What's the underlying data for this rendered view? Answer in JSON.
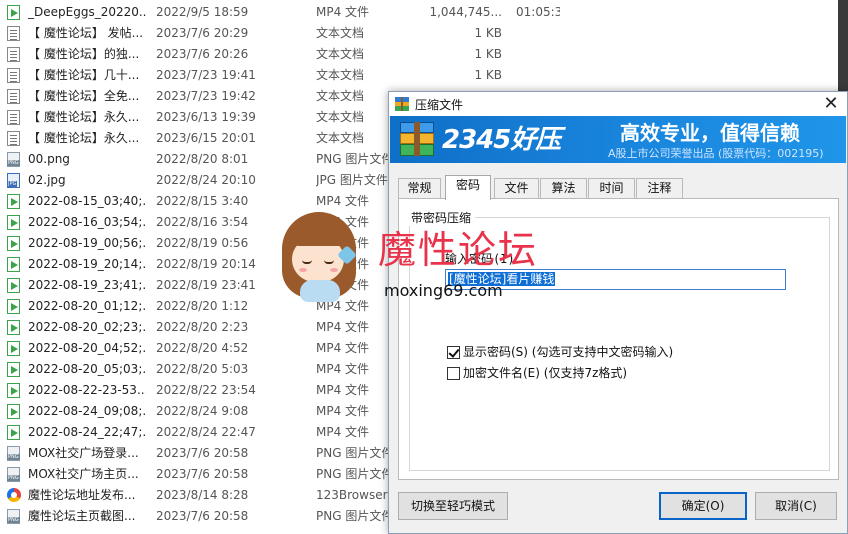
{
  "files": [
    {
      "icon": "mp4",
      "name": "_DeepEggs_20220...",
      "date": "2022/9/5 18:59",
      "type": "MP4 文件",
      "size": "1,044,745...",
      "duration": "01:05:33"
    },
    {
      "icon": "text",
      "name": "【 魔性论坛】 发帖...",
      "date": "2023/7/6 20:29",
      "type": "文本文档",
      "size": "1 KB",
      "duration": ""
    },
    {
      "icon": "text",
      "name": "【 魔性论坛】的独...",
      "date": "2023/7/6 20:26",
      "type": "文本文档",
      "size": "1 KB",
      "duration": ""
    },
    {
      "icon": "text",
      "name": "【 魔性论坛】几十...",
      "date": "2023/7/23 19:41",
      "type": "文本文档",
      "size": "1 KB",
      "duration": ""
    },
    {
      "icon": "text",
      "name": "【 魔性论坛】全免...",
      "date": "2023/7/23 19:42",
      "type": "文本文档",
      "size": "1 KB",
      "duration": ""
    },
    {
      "icon": "text",
      "name": "【 魔性论坛】永久...",
      "date": "2023/6/13 19:39",
      "type": "文本文档",
      "size": "1 KB",
      "duration": ""
    },
    {
      "icon": "text",
      "name": "【 魔性论坛】永久...",
      "date": "2023/6/15 20:01",
      "type": "文本文档",
      "size": "",
      "duration": ""
    },
    {
      "icon": "png",
      "name": "00.png",
      "date": "2022/8/20 8:01",
      "type": "PNG 图片文件",
      "size": "",
      "duration": ""
    },
    {
      "icon": "jpg",
      "name": "02.jpg",
      "date": "2022/8/24 20:10",
      "type": "JPG 图片文件",
      "size": "",
      "duration": ""
    },
    {
      "icon": "mp4",
      "name": "2022-08-15_03;40;...",
      "date": "2022/8/15 3:40",
      "type": "MP4 文件",
      "size": "",
      "duration": ""
    },
    {
      "icon": "mp4",
      "name": "2022-08-16_03;54;...",
      "date": "2022/8/16 3:54",
      "type": "MP4 文件",
      "size": "",
      "duration": ""
    },
    {
      "icon": "mp4",
      "name": "2022-08-19_00;56;...",
      "date": "2022/8/19 0:56",
      "type": "MP4 文件",
      "size": "",
      "duration": ""
    },
    {
      "icon": "mp4",
      "name": "2022-08-19_20;14;...",
      "date": "2022/8/19 20:14",
      "type": "MP4 文件",
      "size": "",
      "duration": ""
    },
    {
      "icon": "mp4",
      "name": "2022-08-19_23;41;...",
      "date": "2022/8/19 23:41",
      "type": "MP4 文件",
      "size": "",
      "duration": ""
    },
    {
      "icon": "mp4",
      "name": "2022-08-20_01;12;...",
      "date": "2022/8/20 1:12",
      "type": "MP4 文件",
      "size": "",
      "duration": ""
    },
    {
      "icon": "mp4",
      "name": "2022-08-20_02;23;...",
      "date": "2022/8/20 2:23",
      "type": "MP4 文件",
      "size": "",
      "duration": ""
    },
    {
      "icon": "mp4",
      "name": "2022-08-20_04;52;...",
      "date": "2022/8/20 4:52",
      "type": "MP4 文件",
      "size": "",
      "duration": ""
    },
    {
      "icon": "mp4",
      "name": "2022-08-20_05;03;...",
      "date": "2022/8/20 5:03",
      "type": "MP4 文件",
      "size": "",
      "duration": ""
    },
    {
      "icon": "mp4",
      "name": "2022-08-22-23-53...",
      "date": "2022/8/22 23:54",
      "type": "MP4 文件",
      "size": "",
      "duration": ""
    },
    {
      "icon": "mp4",
      "name": "2022-08-24_09;08;...",
      "date": "2022/8/24 9:08",
      "type": "MP4 文件",
      "size": "",
      "duration": ""
    },
    {
      "icon": "mp4",
      "name": "2022-08-24_22;47;...",
      "date": "2022/8/24 22:47",
      "type": "MP4 文件",
      "size": "",
      "duration": ""
    },
    {
      "icon": "png",
      "name": "MOX社交广场登录...",
      "date": "2023/7/6 20:58",
      "type": "PNG 图片文件",
      "size": "",
      "duration": ""
    },
    {
      "icon": "png",
      "name": "MOX社交广场主页...",
      "date": "2023/7/6 20:58",
      "type": "PNG 图片文件",
      "size": "",
      "duration": ""
    },
    {
      "icon": "browser",
      "name": "魔性论坛地址发布...",
      "date": "2023/8/14 8:28",
      "type": "123Browser",
      "size": "",
      "duration": ""
    },
    {
      "icon": "png",
      "name": "魔性论坛主页截图...",
      "date": "2023/7/6 20:58",
      "type": "PNG 图片文件",
      "size": "",
      "duration": ""
    }
  ],
  "dialog": {
    "title": "压缩文件",
    "close_glyph": "✕",
    "banner": {
      "brand": "2345好压",
      "slogan": "高效专业，值得信赖",
      "subtitle": "A股上市公司荣誉出品 (股票代码：002195)"
    },
    "tabs": [
      "常规",
      "密码",
      "文件",
      "算法",
      "时间",
      "注释"
    ],
    "active_tab": "密码",
    "group_title": "带密码压缩",
    "password_label": "输入密码(I)",
    "password_value": "[魔性论坛]看片赚钱",
    "show_password": {
      "label": "显示密码(S)  (勾选可支持中文密码输入)",
      "checked": true
    },
    "encrypt_names": {
      "label": "加密文件名(E)  (仅支持7z格式)",
      "checked": false
    },
    "buttons": {
      "switch_mode": "切换至轻巧模式",
      "ok": "确定(O)",
      "cancel": "取消(C)"
    }
  },
  "watermark": {
    "title": "魔性论坛",
    "url": "moxing69.com"
  },
  "colors": {
    "banner_blue": "#1a86de",
    "selection_blue": "#0f6ed5",
    "watermark_red": "#e8334a",
    "mp4_green": "#3aa34b"
  }
}
